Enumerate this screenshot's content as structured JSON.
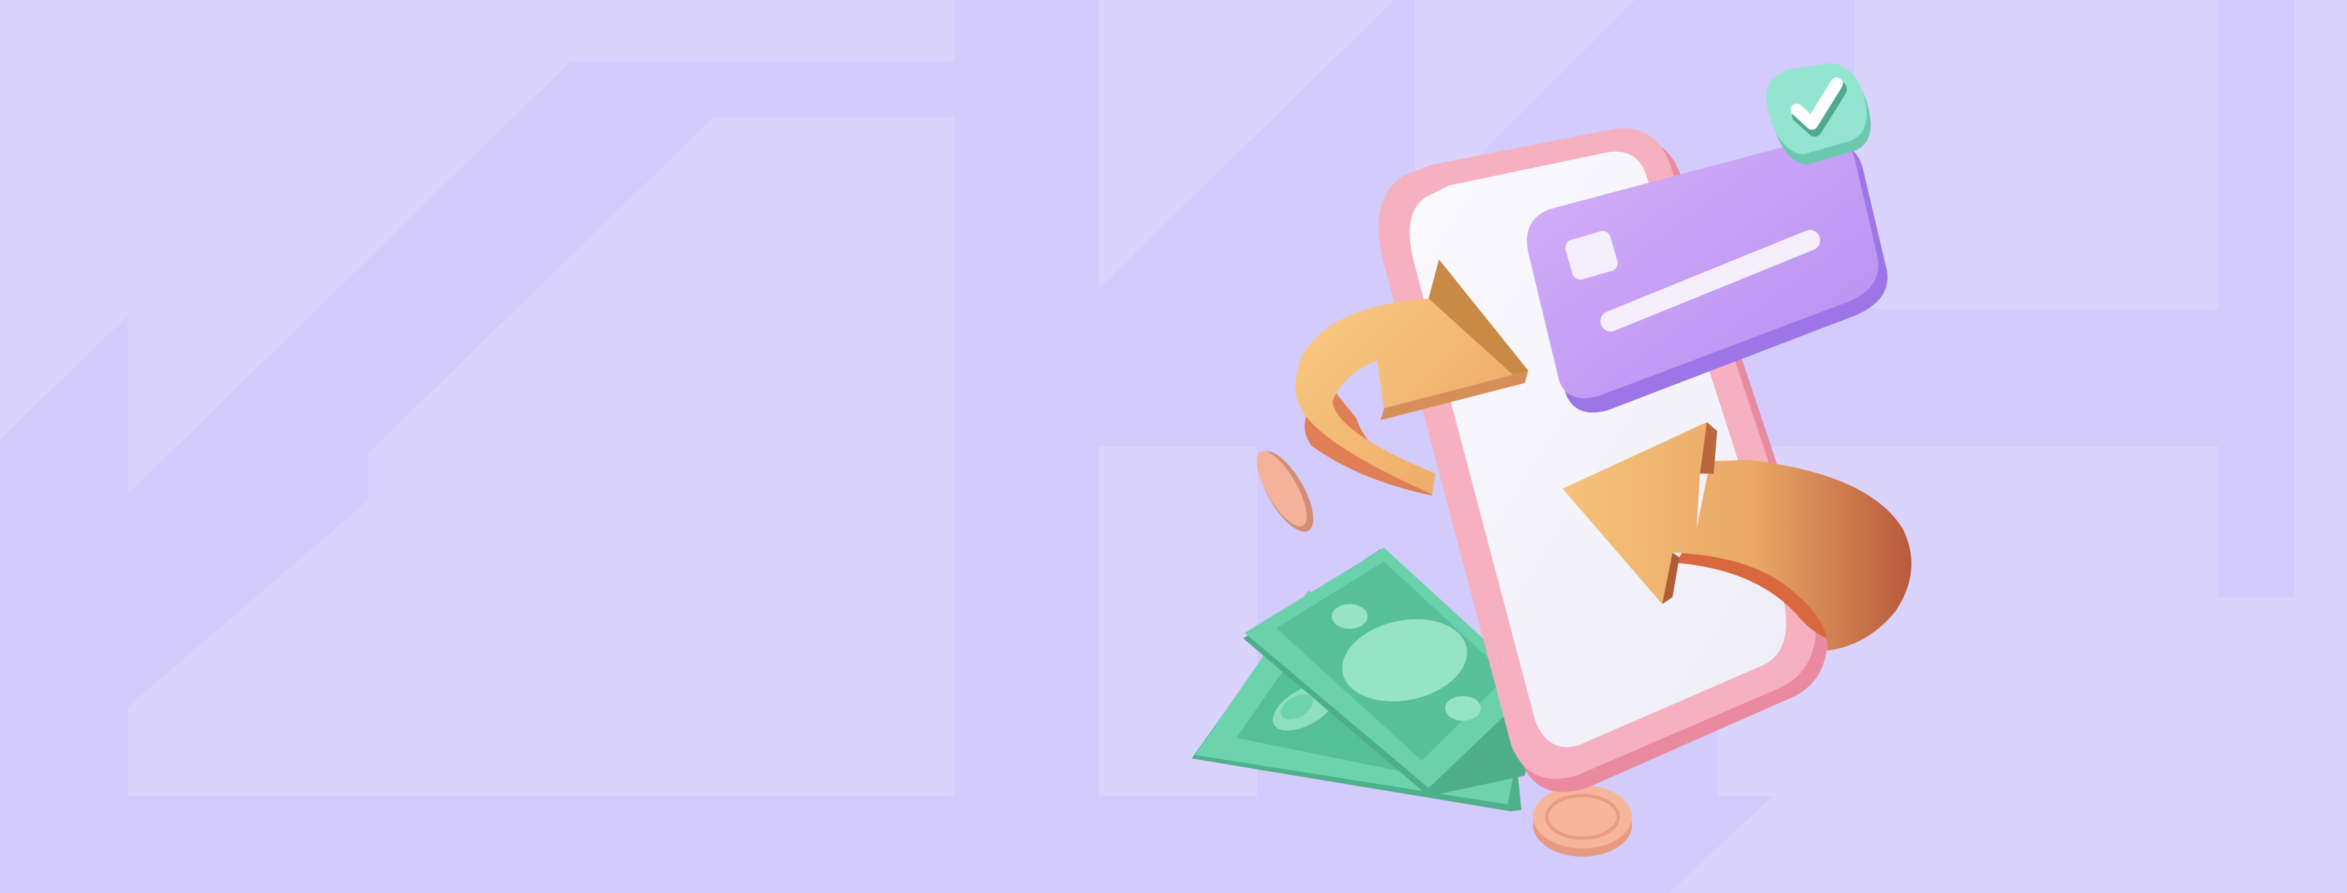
{
  "banner": {
    "colors": {
      "background": "#d2cbfc",
      "background_pattern": "#d9d3fe",
      "phone_frame": "#f3aab8",
      "phone_screen": "#f5f4fa",
      "card": "#c9a2f4",
      "card_shadow": "#9a74e2",
      "check_badge": "#8fe3cf",
      "arrows": "#f6c07a",
      "arrows_shadow": "#e07c4d",
      "banknotes": "#5fcaa3",
      "banknotes_light": "#96e2c6",
      "coins": "#f2a98e"
    },
    "icons": [
      "smartphone-icon",
      "credit-card-icon",
      "checkmark-icon",
      "exchange-arrows-icon",
      "banknote-icon",
      "coin-icon"
    ]
  }
}
